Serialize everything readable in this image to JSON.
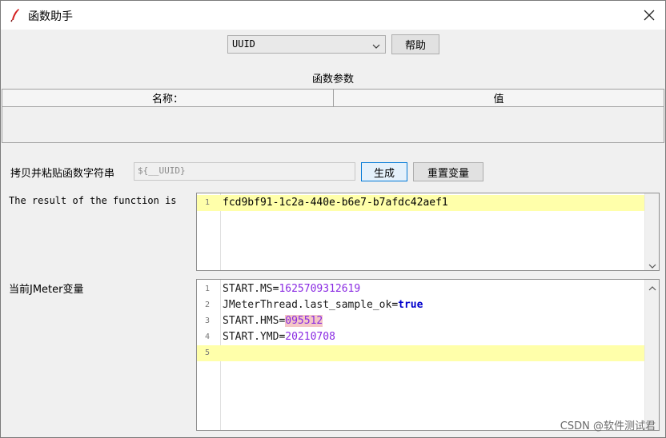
{
  "window": {
    "title": "函数助手"
  },
  "toolbar": {
    "function_selected": "UUID",
    "help_label": "帮助"
  },
  "parameters": {
    "section_title": "函数参数",
    "columns": [
      "名称：",
      "值"
    ]
  },
  "copy_paste": {
    "label": "拷贝并粘贴函数字符串",
    "function_string": "${__UUID}",
    "generate_label": "生成",
    "reset_label": "重置变量"
  },
  "result": {
    "label": "The result of the function is",
    "lines": [
      {
        "num": "1",
        "text": "fcd9bf91-1c2a-440e-b6e7-b7afdc42aef1"
      }
    ]
  },
  "variables": {
    "label": "当前JMeter变量",
    "lines": [
      {
        "num": "1",
        "key": "START.MS",
        "eq": "=",
        "value": "1625709312619"
      },
      {
        "num": "2",
        "key": "JMeterThread.last_sample_ok",
        "eq": "=",
        "value": "true"
      },
      {
        "num": "3",
        "key": "START.HMS",
        "eq": "=",
        "value": "095512"
      },
      {
        "num": "4",
        "key": "START.YMD",
        "eq": "=",
        "value": "20210708"
      },
      {
        "num": "5",
        "key": "",
        "eq": "",
        "value": ""
      }
    ]
  },
  "watermark": "CSDN @软件测试君",
  "colors": {
    "highlight": "#ffffaa",
    "number": "#8a2be2",
    "boolean": "#0000cc",
    "accent": "#0078d7"
  }
}
